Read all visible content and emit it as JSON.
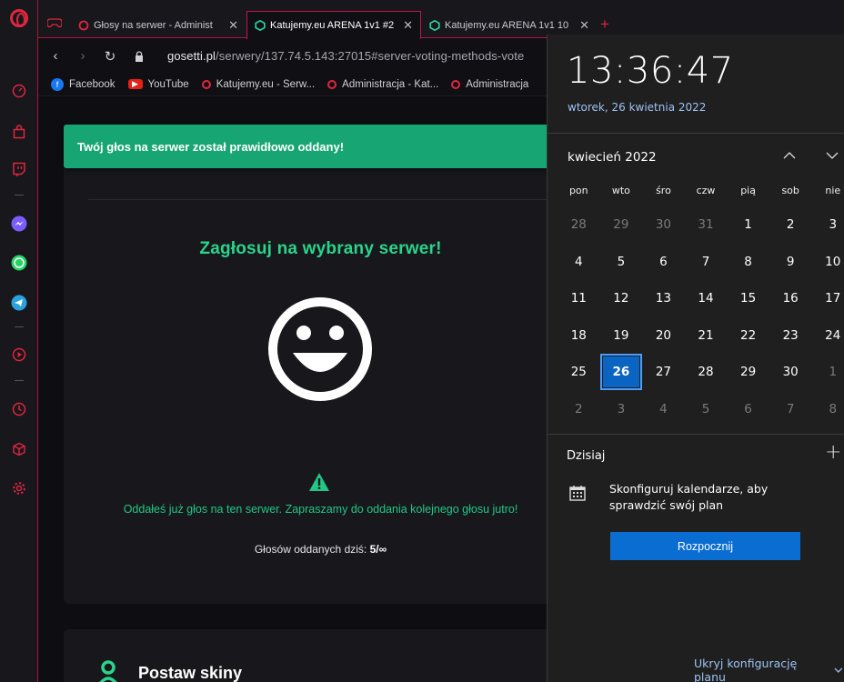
{
  "tabs": [
    {
      "label": "Głosy na serwer - Administ",
      "active": false
    },
    {
      "label": "Katujemy.eu ARENA 1v1 #2",
      "active": true
    },
    {
      "label": "Katujemy.eu ARENA 1v1 10",
      "active": false
    }
  ],
  "address": {
    "url_host": "gosetti.pl",
    "url_path": "/serwery/137.74.5.143:27015#server-voting-methods-vote"
  },
  "bookmarks": [
    "Facebook",
    "YouTube",
    "Katujemy.eu - Serw...",
    "Administracja - Kat...",
    "Administracja"
  ],
  "page": {
    "alert": "Twój głos na serwer został prawidłowo oddany!",
    "vote_title": "Zagłosuj na wybrany serwer!",
    "voted_msg": "Oddałeś już głos na ten serwer. Zapraszamy do oddania kolejnego głosu jutro!",
    "count_label": "Głosów oddanych dziś:",
    "count_value": "5/∞",
    "skins_title": "Postaw skiny"
  },
  "flyout": {
    "time": "13:36:47",
    "date": "wtorek, 26 kwietnia 2022",
    "month": "kwiecień 2022",
    "weekdays": [
      "pon",
      "wto",
      "śro",
      "czw",
      "pią",
      "sob",
      "nie"
    ],
    "weeks": [
      [
        "28",
        "29",
        "30",
        "31",
        "1",
        "2",
        "3"
      ],
      [
        "4",
        "5",
        "6",
        "7",
        "8",
        "9",
        "10"
      ],
      [
        "11",
        "12",
        "13",
        "14",
        "15",
        "16",
        "17"
      ],
      [
        "18",
        "19",
        "20",
        "21",
        "22",
        "23",
        "24"
      ],
      [
        "25",
        "26",
        "27",
        "28",
        "29",
        "30",
        "1"
      ],
      [
        "2",
        "3",
        "4",
        "5",
        "6",
        "7",
        "8"
      ]
    ],
    "today_label": "Dzisiaj",
    "config_text": "Skonfiguruj kalendarze, aby sprawdzić swój plan",
    "start_button": "Rozpocznij",
    "hide_link": "Ukryj konfigurację planu"
  },
  "colors": {
    "accent_green": "#29d48b",
    "alert_bg": "#17a673",
    "opera_red": "#e0263f",
    "win_blue": "#0a6dd1"
  }
}
